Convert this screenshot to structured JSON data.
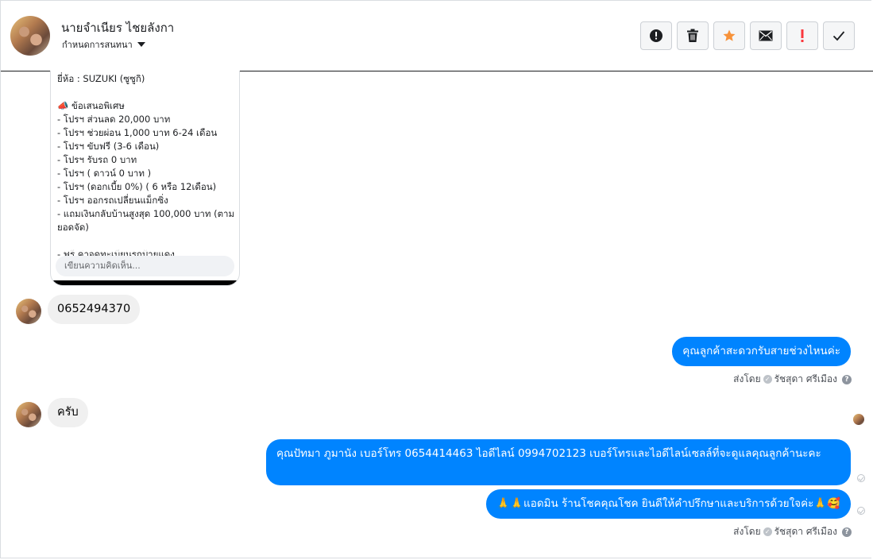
{
  "header": {
    "contact_name": "นายจำเนียร ไชยลังกา",
    "conversation_settings_label": "กำหนดการสนทนา",
    "actions": [
      {
        "name": "report-spam-button",
        "icon": "alert-circle-icon"
      },
      {
        "name": "delete-button",
        "icon": "trash-icon"
      },
      {
        "name": "star-button",
        "icon": "star-icon",
        "color": "#f7923a"
      },
      {
        "name": "mark-unread-button",
        "icon": "envelope-icon"
      },
      {
        "name": "follow-up-button",
        "icon": "exclamation-icon",
        "color": "#fa383e"
      },
      {
        "name": "mark-done-button",
        "icon": "checkmark-icon"
      }
    ]
  },
  "post_card": {
    "lines": [
      "ยี่ห้อ : SUZUKI (ซูซูกิ)",
      "",
      "📣 ข้อเสนอพิเศษ",
      "- โปรฯ ส่วนลด 20,000 บาท",
      "- โปรฯ ช่วยผ่อน 1,000 บาท 6-24 เดือน",
      "- โปรฯ ขับฟรี (3-6 เดือน)",
      "- โปรฯ รับรถ 0 บาท",
      "- โปรฯ ( ดาวน์ 0 บาท )",
      "- โปรฯ (ดอกเบี้ย 0%) ( 6 หรือ 12เดือน)",
      "- โปรฯ ออกรถเปลี่ยนแม็กซิ่ง",
      "- แถมเงินกลับบ้านสูงสุด 100,000 บาท (ตามยอดจัด)",
      "",
      "- ฟรี ค่าจดทะเบียนรถป้ายแดง"
    ],
    "comment_placeholder": "เขียนความคิดเห็น..."
  },
  "messages": {
    "incoming_phone": "0652494370",
    "outgoing_ask_time": "คุณลูกค้าสะดวกรับสายช่วงไหนค่ะ",
    "sent_by_1": {
      "prefix": "ส่งโดย",
      "agent": "รัชสุดา ศรีเมือง"
    },
    "incoming_reply": "ครับ",
    "outgoing_contact_info": "คุณปัทมา ภูมานัง    เบอร์โทร 0654414463  ไอดีไลน์ 0994702123   เบอร์โทรและไอดีไลน์เซลล์ที่จะดูแลคุณลูกค้านะคะ",
    "outgoing_signoff": "🙏🙏แอดมิน ร้านโชคคุณโชค ยินดีให้คำปรึกษาและบริการด้วยใจค่ะ🙏🥰",
    "sent_by_2": {
      "prefix": "ส่งโดย",
      "agent": "รัชสุดา ศรีเมือง"
    }
  },
  "colors": {
    "outgoing_bubble": "#0084ff",
    "incoming_bubble": "#f0f0f0"
  }
}
